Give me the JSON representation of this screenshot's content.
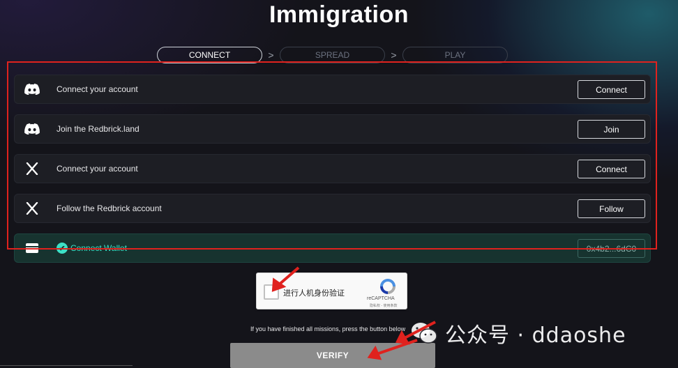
{
  "page": {
    "title": "Immigration"
  },
  "steps": [
    {
      "label": "CONNECT",
      "active": true
    },
    {
      "label": "SPREAD",
      "active": false
    },
    {
      "label": "PLAY",
      "active": false
    }
  ],
  "step_separator": ">",
  "tasks": [
    {
      "icon": "discord-icon",
      "label": "Connect your account",
      "button": "Connect"
    },
    {
      "icon": "discord-icon",
      "label": "Join the Redbrick.land",
      "button": "Join"
    },
    {
      "icon": "x-logo-icon",
      "label": "Connect your account",
      "button": "Connect"
    },
    {
      "icon": "x-logo-icon",
      "label": "Follow the Redbrick account",
      "button": "Follow"
    }
  ],
  "wallet": {
    "icon": "wallet-icon",
    "label": "Connect Wallet",
    "check": "✔",
    "address": "0x4b2...6dC0"
  },
  "captcha": {
    "prompt": "进行人机身份验证",
    "brand": "reCAPTCHA",
    "links": "隐私权 - 使用条款"
  },
  "hint": "If you have finished all missions, press the button below",
  "verify_label": "VERIFY",
  "watermark": {
    "text": "公众号 · ddaoshe",
    "icon": "wechat-icon"
  },
  "colors": {
    "accent": "#3ee0c6",
    "annotation_red": "#e0221e",
    "panel": "#1d1e24",
    "verify_bg": "#8b8b8b"
  }
}
